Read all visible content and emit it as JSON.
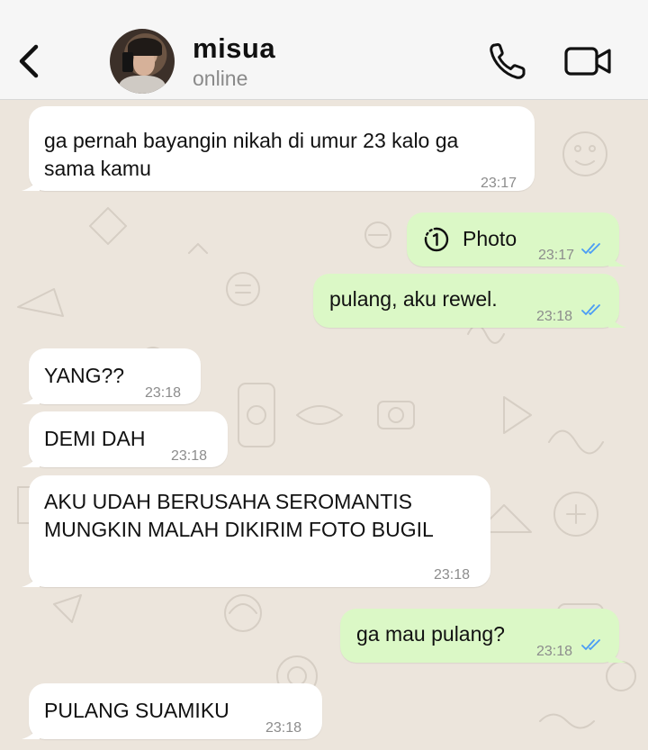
{
  "header": {
    "contact_name": "misua",
    "contact_status": "online"
  },
  "colors": {
    "incoming_bubble": "#ffffff",
    "outgoing_bubble": "#dbf8c6",
    "read_ticks": "#4a9cf5",
    "wallpaper": "#ece5dc"
  },
  "messages": [
    {
      "direction": "in",
      "lines": [
        "ga pernah bayangin nikah di umur 23 kalo ga",
        "sama kamu"
      ],
      "time": "23:17"
    },
    {
      "direction": "out",
      "type": "photo",
      "label": "Photo",
      "time": "23:17",
      "status": "read"
    },
    {
      "direction": "out",
      "lines": [
        "pulang, aku rewel."
      ],
      "time": "23:18",
      "status": "read"
    },
    {
      "direction": "in",
      "lines": [
        "YANG??"
      ],
      "time": "23:18"
    },
    {
      "direction": "in",
      "lines": [
        "DEMI DAH"
      ],
      "time": "23:18"
    },
    {
      "direction": "in",
      "lines": [
        "AKU UDAH BERUSAHA SEROMANTIS",
        "MUNGKIN MALAH DIKIRIM FOTO BUGIL"
      ],
      "time": "23:18"
    },
    {
      "direction": "out",
      "lines": [
        "ga mau pulang?"
      ],
      "time": "23:18",
      "status": "read"
    },
    {
      "direction": "in",
      "lines": [
        "PULANG SUAMIKU"
      ],
      "time": "23:18"
    }
  ]
}
